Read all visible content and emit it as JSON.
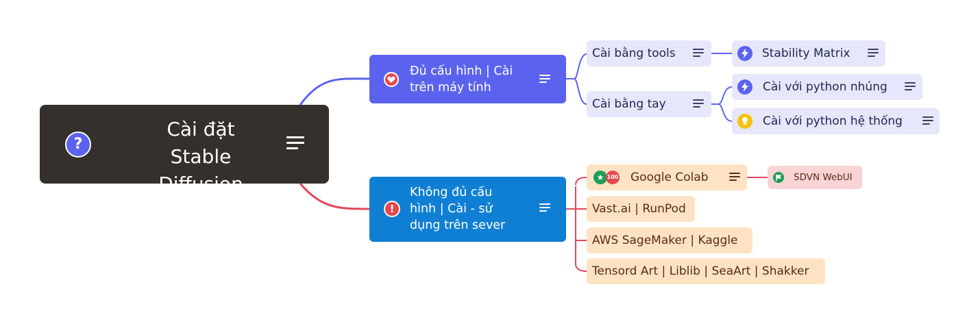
{
  "root": {
    "line1": "Cài đặt",
    "line2": "Stable Diffusion",
    "icon": "question-circle-icon"
  },
  "branch_local": {
    "line1": "Đủ cấu hình | Cài",
    "line2": "trên máy tính",
    "icon": "heart-icon",
    "children": {
      "tools": {
        "label": "Cài bằng tools",
        "child": {
          "label": "Stability Matrix",
          "icon": "lightning-icon"
        }
      },
      "manual": {
        "label": "Cài bằng tay",
        "children": [
          {
            "label": "Cài với python nhúng",
            "icon": "lightning-icon"
          },
          {
            "label": "Cài với python hệ thống",
            "icon": "lightbulb-icon"
          }
        ]
      }
    }
  },
  "branch_server": {
    "line1": "Không đủ cấu",
    "line2": "hình | Cài - sử",
    "line3": "dụng trên sever",
    "icon": "exclamation-icon",
    "children": [
      {
        "label": "Google Colab",
        "icons": [
          "star-icon",
          "score-100-icon"
        ],
        "child": {
          "label": "SDVN WebUI",
          "icon": "flag-icon"
        }
      },
      {
        "label": "Vast.ai | RunPod"
      },
      {
        "label": "AWS SageMaker | Kaggle"
      },
      {
        "label": "Tensord Art | Liblib | SeaArt | Shakker"
      }
    ]
  },
  "colors": {
    "root_bg": "#35302b",
    "local_bg": "#5b63ee",
    "server_bg": "#0f7fd3",
    "local_link": "#5b63ee",
    "server_link": "#e0485a",
    "sub_blue": "#e6e7fb",
    "sub_orange": "#fde3c4",
    "pink": "#f8d4d4"
  }
}
